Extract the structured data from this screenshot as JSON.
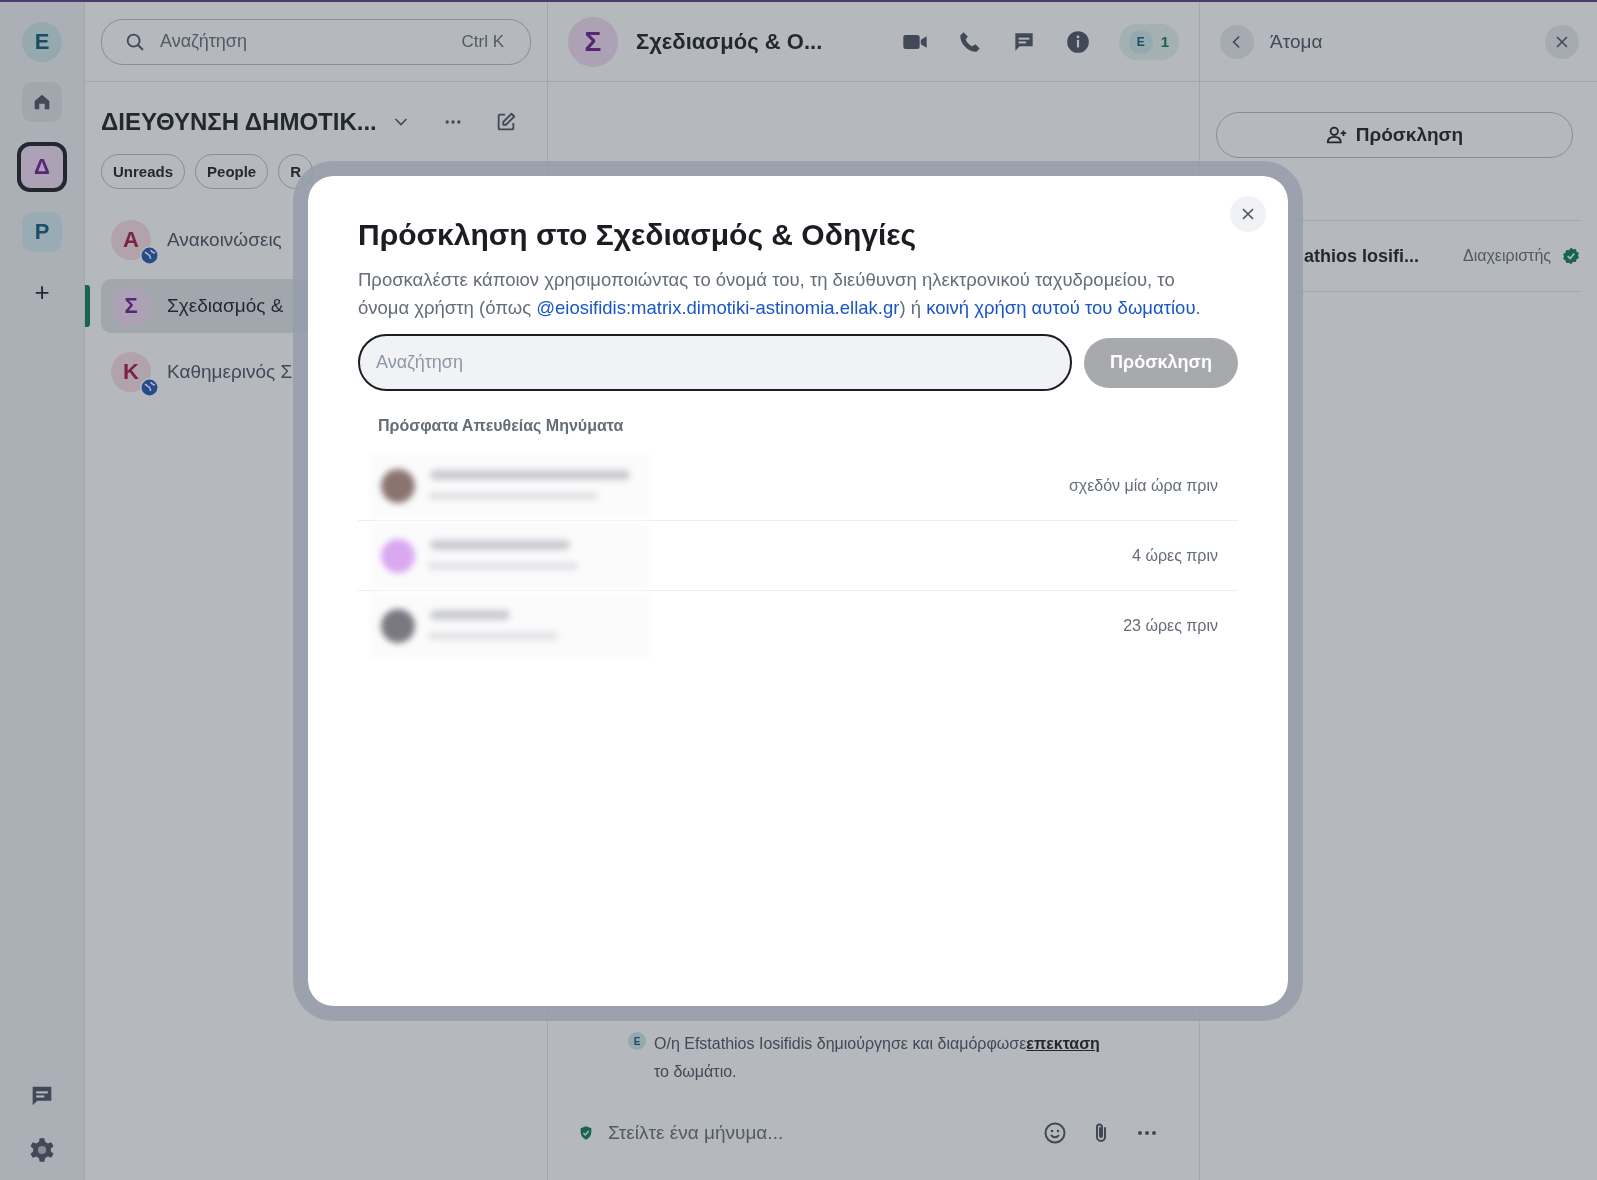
{
  "spaces": {
    "user": {
      "initial": "E"
    },
    "items": [
      {
        "kind": "home",
        "selected": false
      },
      {
        "kind": "space",
        "label": "Δ",
        "selected": true
      },
      {
        "kind": "space",
        "label": "P",
        "selected": false
      },
      {
        "kind": "add",
        "label": "+",
        "selected": false
      }
    ]
  },
  "room_list": {
    "search": {
      "placeholder": "Αναζήτηση",
      "shortcut": "Ctrl K"
    },
    "space_title": "ΔΙΕΥΘΥΝΣΗ ΔΗΜΟΤΙΚ...",
    "filters": [
      {
        "label": "Unreads",
        "selected": false
      },
      {
        "label": "People",
        "selected": false
      },
      {
        "label": "R",
        "selected": false
      }
    ],
    "rooms": [
      {
        "initial": "A",
        "name": "Ανακοινώσεις",
        "public": true,
        "selected": false
      },
      {
        "initial": "Σ",
        "name": "Σχεδιασμός &",
        "public": false,
        "selected": true
      },
      {
        "initial": "K",
        "name": "Καθημερινός Σ",
        "public": true,
        "selected": false
      }
    ]
  },
  "room": {
    "initial": "Σ",
    "name": "Σχεδιασμός & Ο...",
    "facepile": {
      "initial": "E",
      "count": "1"
    },
    "event": {
      "initial": "E",
      "text": "Ο/η Efstathios Iosifidis δημιούργησε και διαμόρφωσε",
      "link": "επεκταση",
      "text_after": "το δωμάτιο."
    },
    "composer": {
      "placeholder": "Στείλτε ένα μήνυμα..."
    }
  },
  "right_panel": {
    "title": "Άτομα",
    "invite_button": "Πρόσκληση",
    "members": [
      {
        "name": "athios Iosifi...",
        "role": "Διαχειριστής",
        "verified": true
      }
    ]
  },
  "dialog": {
    "title": "Πρόσκληση στο Σχεδιασμός & Οδηγίες",
    "description": [
      {
        "kind": "text",
        "text": "Προσκαλέστε κάποιον χρησιμοποιώντας το όνομά του, τη διεύθυνση ηλεκτρονικού ταχυδρομείου, το όνομα χρήστη (όπως "
      },
      {
        "kind": "link",
        "text": "@eiosifidis:matrix.dimotiki-astinomia.ellak.gr"
      },
      {
        "kind": "text",
        "text": ") ή "
      },
      {
        "kind": "link",
        "text": "κοινή χρήση αυτού του δωματίου"
      },
      {
        "kind": "text",
        "text": "."
      }
    ],
    "search": {
      "placeholder": "Αναζήτηση"
    },
    "invite_button": {
      "label": "Πρόσκληση",
      "disabled": true
    },
    "section_title": "Πρόσφατα Απευθείας Μηνύματα",
    "recent": [
      {
        "time": "σχεδόν μία ώρα πριν"
      },
      {
        "time": "4 ώρες πριν"
      },
      {
        "time": "23 ώρες πριν"
      }
    ]
  }
}
